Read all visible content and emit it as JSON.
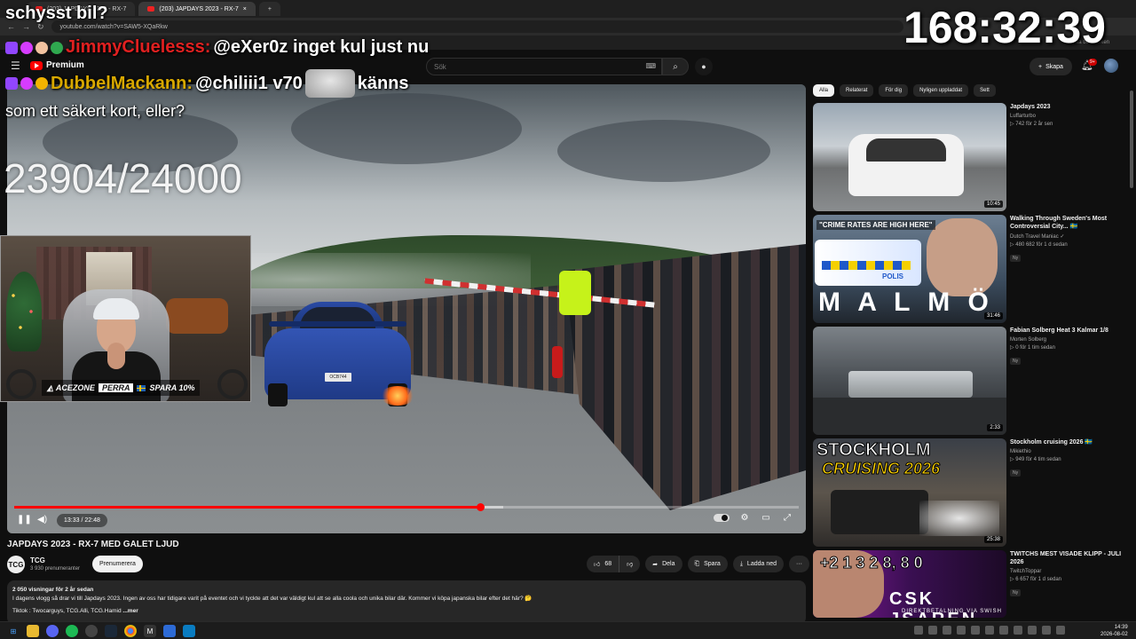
{
  "browser": {
    "tabs": [
      {
        "label": "(203) JAPDAYS 2023 - RX-7"
      },
      {
        "label": "(203) JAPDAYS 2023 - RX-7"
      }
    ],
    "new_tab": "+",
    "url": "youtube.com/watch?v=SAW5-XQaRkw",
    "bookmarks_right": "Alla bokmärken"
  },
  "header": {
    "logo": "Premium",
    "search_placeholder": "Sök",
    "create_label": "Skapa",
    "notification_count": "9+"
  },
  "overlay": {
    "title": "schysst bil?",
    "timer": "168:32:39",
    "chat": [
      {
        "user": "JimmyCluelesss:",
        "user_color": "#e02020",
        "message": "@eXer0z inget kul just nu"
      },
      {
        "user": "DubbelMackann:",
        "user_color": "#d8a800",
        "message": "@chiliii1 v70",
        "message_tail": "känns"
      }
    ],
    "chat_continuation": "som ett säkert kort, eller?",
    "goal": "23904/24000"
  },
  "webcam": {
    "brand": "ACEZONE",
    "code": "PERRA",
    "offer": "SPARA 10%"
  },
  "player": {
    "time": "13:33 / 22:48",
    "progress": 0.5943,
    "buffered": 0.623,
    "plate": "OCB744"
  },
  "video": {
    "title": "JAPDAYS 2023 - RX-7 MED GALET LJUD",
    "channel": "TCG",
    "channel_avatar": "TCG",
    "subscribers": "3 930 prenumeranter",
    "subscribe_label": "Prenumerera",
    "likes": "68",
    "share_label": "Dela",
    "save_label": "Spara",
    "download_label": "Ladda ned",
    "more": "···"
  },
  "description": {
    "meta": "2 050 visningar  för 2 år sedan",
    "text": "I dagens vlogg så drar vi till Japdays 2023. Ingen av oss har tidigare varit på eventet och vi tyckte att det var väldigt kul att se alla coola och unika bilar där. Kommer vi köpa japanska bilar efter det här? 🤔",
    "links": "Tiktok : Twocarguys, TCG.Alli, TCG.Hamid",
    "more_label": "...mer"
  },
  "sidebar": {
    "chips": [
      "Alla",
      "Relaterat",
      "För dig",
      "Nyligen uppladdat",
      "Sett"
    ],
    "items": [
      {
        "title": "Japdays 2023",
        "channel": "Luffarturbo",
        "stats": "▷ 742  för 2 år sen",
        "duration": "10:45",
        "badge": ""
      },
      {
        "title": "Walking Through Sweden's Most Controversial City... 🇸🇪",
        "channel": "Dutch Travel Maniac ✓",
        "stats": "▷ 480 682  för 1 d sedan",
        "duration": "31:46",
        "badge": "Ny",
        "thumb_text": "M A L M Ö",
        "thumb_banner": "\"CRIME RATES ARE HIGH HERE\"",
        "thumb_sign": "POLIS"
      },
      {
        "title": "Fabian Solberg Heat 3 Kalmar 1/8",
        "channel": "Morten Solberg",
        "stats": "▷ 0  för 1 tim sedan",
        "duration": "2:33",
        "badge": "Ny"
      },
      {
        "title": "Stockholm cruising 2026 🇸🇪",
        "channel": "Mikiethio",
        "stats": "▷ 949  för 4 tim sedan",
        "duration": "25:38",
        "badge": "Ny",
        "thumb_text": "STOCKHOLM",
        "thumb_text2": "CRUISING 2026"
      },
      {
        "title": "TWITCHS MEST VISADE KLIPP - JULI 2026",
        "channel": "TwitchToppar",
        "stats": "▷ 6 657  för 1 d sedan",
        "duration": "",
        "badge": "Ny",
        "thumb_text": "+2 1 3 2 8, 8 0",
        "thumb_text2": "CSK JSAREN",
        "thumb_text3": "DIREKTBETALNING VIA SWISH"
      }
    ]
  },
  "taskbar": {
    "time": "14:39",
    "date": "2026-08-02"
  }
}
